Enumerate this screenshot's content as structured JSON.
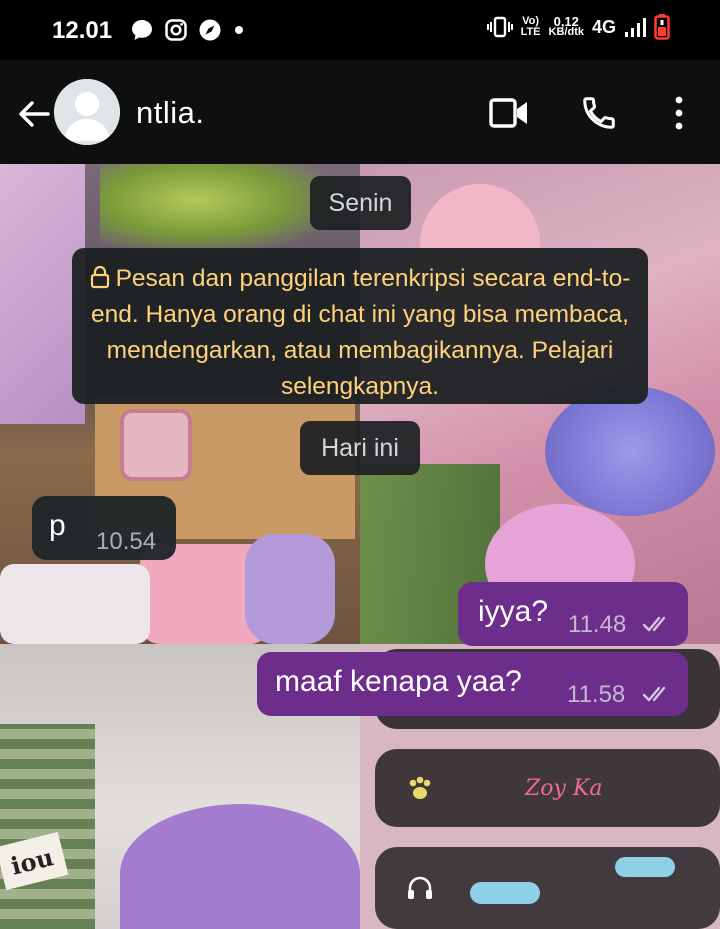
{
  "status_bar": {
    "time": "12.01",
    "volte_top": "Vo)",
    "volte_bottom": "LTE",
    "speed_value": "0,12",
    "speed_unit": "KB/dtk",
    "network": "4G"
  },
  "header": {
    "contact_name": "ntlia."
  },
  "chat": {
    "date_chip_1": "Senin",
    "encryption_notice": "Pesan dan panggilan terenkripsi secara end-to-end. Hanya orang di chat ini yang bisa membaca, mendengarkan, atau membagikannya. Pelajari selengkapnya.",
    "date_chip_2": "Hari ini",
    "messages": [
      {
        "direction": "incoming",
        "text": "p",
        "time": "10.54"
      },
      {
        "direction": "outgoing",
        "text": "iyya?",
        "time": "11.48",
        "status": "read"
      },
      {
        "direction": "outgoing",
        "text": "maaf kenapa yaa?",
        "time": "11.58",
        "status": "read"
      }
    ]
  },
  "wallpaper_text": {
    "pouch_label": "iou",
    "sticker_text": "Zoy Ka"
  },
  "colors": {
    "outgoing_bubble": "#6d2e8b",
    "incoming_bubble": "#202629",
    "notice_text": "#ffd279",
    "header_bg": "#0f0f0f"
  },
  "icons": [
    "back-arrow-icon",
    "avatar-icon",
    "video-call-icon",
    "phone-call-icon",
    "more-menu-icon",
    "lock-icon",
    "double-check-icon"
  ]
}
